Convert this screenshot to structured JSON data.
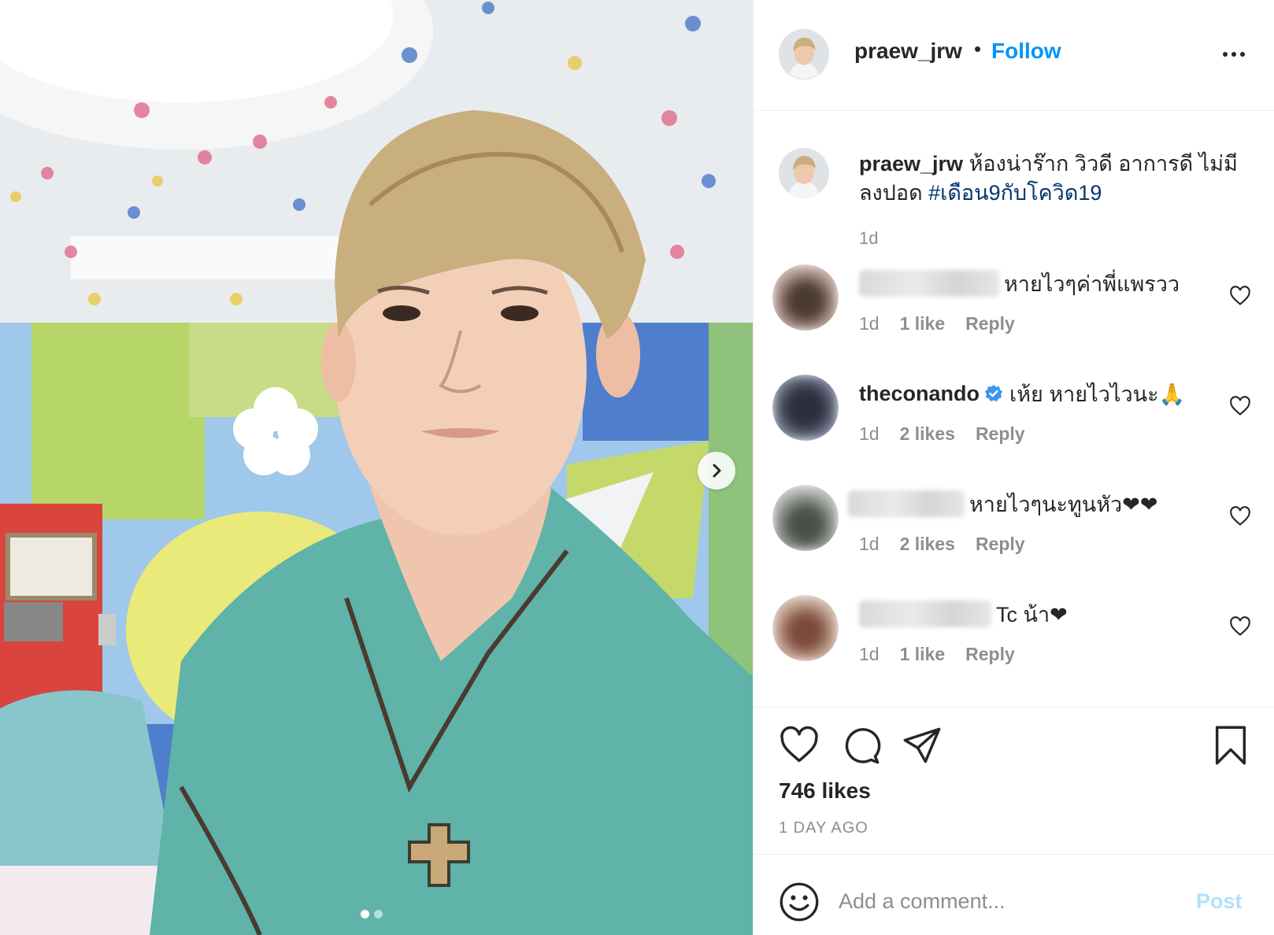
{
  "colors": {
    "accent": "#0095f6",
    "hashtag": "#00376b",
    "muted": "#8e8e8e",
    "post_disabled": "#b2dffc",
    "emoji_heart": "#ed1c24"
  },
  "header": {
    "username": "praew_jrw",
    "separator": "•",
    "follow_label": "Follow",
    "more_icon": "more-options-icon"
  },
  "caption": {
    "username": "praew_jrw",
    "text": "ห้องน่าร๊าก วิวดี อาการดี ไม่มีลงปอด",
    "hashtag": "#เดือน9กับโควิด19",
    "time": "1d"
  },
  "comments": [
    {
      "user": "",
      "text": "หายไวๆค่าพี่แพรวว",
      "time": "1d",
      "likes": "1 like",
      "reply": "Reply",
      "verified": false
    },
    {
      "user": "theconando",
      "text": "เห้ย หายไวไวนะ🙏",
      "time": "1d",
      "likes": "2 likes",
      "reply": "Reply",
      "verified": true
    },
    {
      "user": "",
      "text": "หายไวๆนะทูนหัว❤❤",
      "time": "1d",
      "likes": "2 likes",
      "reply": "Reply",
      "verified": false
    },
    {
      "user": "",
      "text": "Tc น้า❤",
      "time": "1d",
      "likes": "1 like",
      "reply": "Reply",
      "verified": false
    }
  ],
  "actions": {
    "icons": [
      "heart-icon",
      "comment-icon",
      "share-icon",
      "bookmark-icon"
    ]
  },
  "likes": "746 likes",
  "date": "1 DAY AGO",
  "add_comment": {
    "placeholder": "Add a comment...",
    "post_label": "Post"
  },
  "carousel": {
    "current": 1,
    "total": 2
  }
}
